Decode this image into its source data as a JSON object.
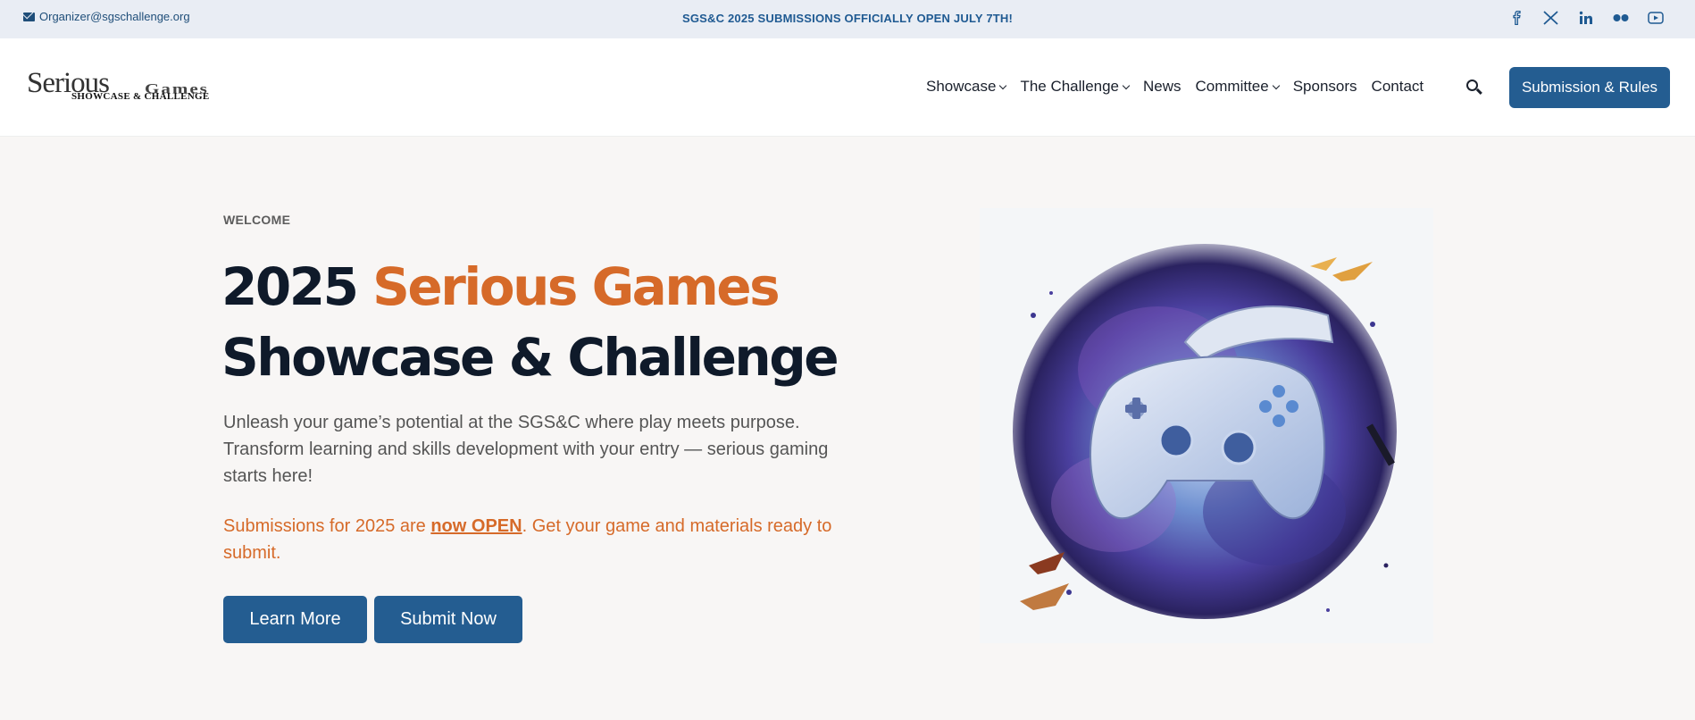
{
  "topbar": {
    "email": "Organizer@sgschallenge.org",
    "announcement": "SGS&C 2025 SUBMISSIONS OFFICIALLY OPEN JULY 7TH!",
    "social_icons": [
      "facebook-icon",
      "x-icon",
      "linkedin-icon",
      "flickr-icon",
      "youtube-icon"
    ]
  },
  "header": {
    "logo": {
      "line1": "Serious",
      "line2": "Games",
      "line3": "SHOWCASE & CHALLENGE"
    },
    "nav": [
      {
        "label": "Showcase",
        "dropdown": true
      },
      {
        "label": "The Challenge",
        "dropdown": true
      },
      {
        "label": "News",
        "dropdown": false
      },
      {
        "label": "Committee",
        "dropdown": true
      },
      {
        "label": "Sponsors",
        "dropdown": false
      },
      {
        "label": "Contact",
        "dropdown": false
      }
    ],
    "cta_label": "Submission & Rules"
  },
  "hero": {
    "eyebrow": "WELCOME",
    "title_part1": "2025 ",
    "title_accent": "Serious Games",
    "title_part2": "Showcase & Challenge",
    "description": "Unleash your game’s potential at the SGS&C where play meets purpose. Transform learning and skills development with your entry — serious gaming starts here!",
    "notice_prefix": "Submissions for 2025 are ",
    "notice_link": "now OPEN",
    "notice_suffix": ". Get your game and materials ready to submit.",
    "buttons": {
      "learn_more": "Learn More",
      "submit_now": "Submit Now"
    }
  },
  "colors": {
    "accent_orange": "#d66a29",
    "primary_blue": "#245d91",
    "topbar_bg": "#e9edf4",
    "page_bg": "#f8f6f5"
  }
}
